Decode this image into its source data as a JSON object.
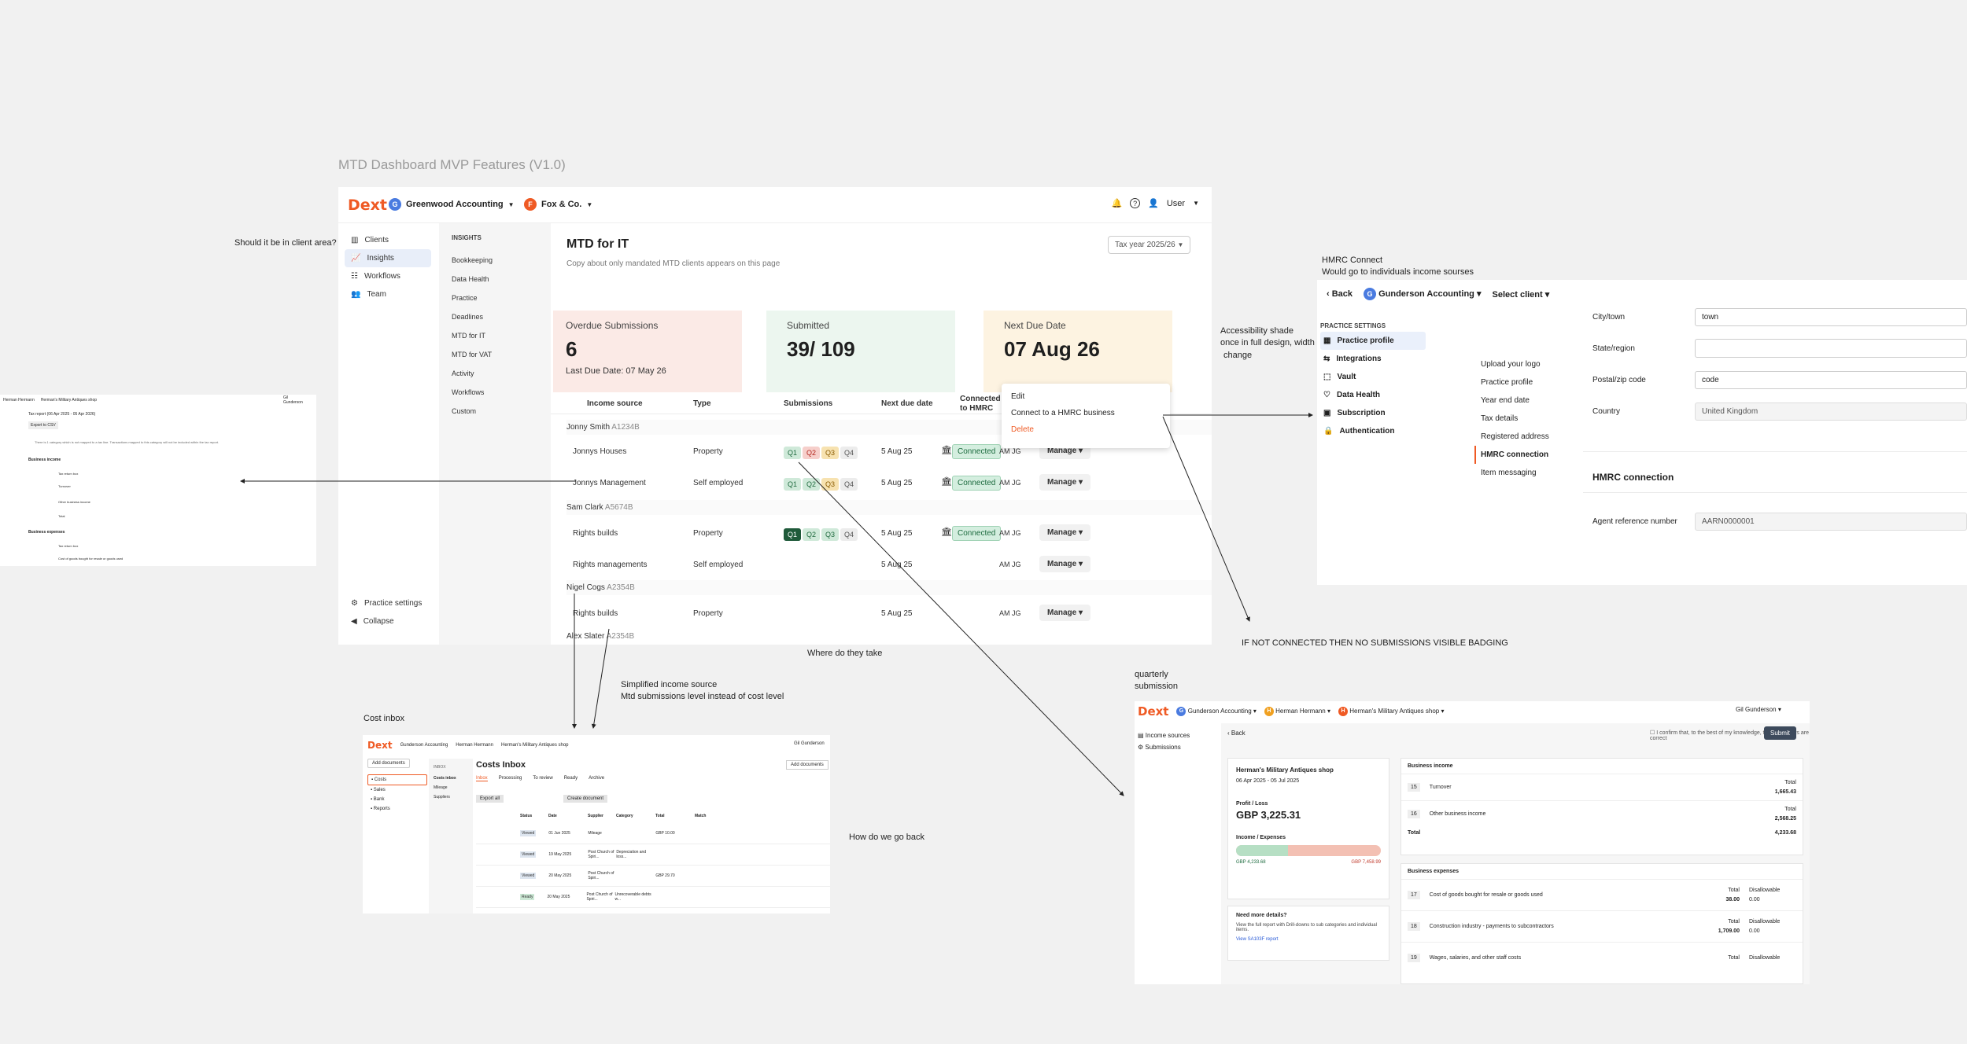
{
  "board": {
    "title": "MTD Dashboard MVP Features (V1.0)"
  },
  "notes": {
    "client_area": "Should it be in client area?",
    "hmrc_connect_1": "HMRC Connect",
    "hmrc_connect_2": "Would go to individuals income sourses",
    "accessibility_1": "Accessibility shade",
    "accessibility_2": "once in full design, width",
    "accessibility_3": "change",
    "not_connected": "IF NOT CONNECTED THEN NO SUBMISSIONS VISIBLE BADGING",
    "where_take": "Where do they take",
    "simplified_1": "Simplified income source",
    "simplified_2": "Mtd submissions level instead of cost level",
    "cost_inbox": "Cost inbox",
    "quarterly_1": "quarterly",
    "quarterly_2": "submission",
    "go_back": "How do we go back"
  },
  "main": {
    "logo": "Dext",
    "org_avatar": "G",
    "org_name": "Greenwood Accounting",
    "client_avatar": "F",
    "client_name": "Fox & Co.",
    "user_label": "User",
    "nav": [
      {
        "label": "Clients"
      },
      {
        "label": "Insights"
      },
      {
        "label": "Workflows"
      },
      {
        "label": "Team"
      }
    ],
    "practice_settings": "Practice settings",
    "collapse": "Collapse",
    "insights_heading": "INSIGHTS",
    "insights_items": [
      "Bookkeeping",
      "Data Health",
      "Practice",
      "Deadlines",
      "MTD for IT",
      "MTD for VAT",
      "Activity",
      "Workflows",
      "Custom"
    ],
    "page_title": "MTD for IT",
    "page_subtitle": "Copy about only mandated MTD clients appears on this page",
    "tax_year": "Tax year 2025/26",
    "cards": {
      "overdue_label": "Overdue Submissions",
      "overdue_value": "6",
      "overdue_sub": "Last Due Date: 07 May 26",
      "submitted_label": "Submitted",
      "submitted_value": "39/ 109",
      "next_label": "Next Due Date",
      "next_value": "07 Aug 26"
    },
    "table_headers": {
      "income": "Income source",
      "type": "Type",
      "submissions": "Submissions",
      "due": "Next due date",
      "connected": "Connected to HMRC"
    },
    "context_menu": {
      "edit": "Edit",
      "connect": "Connect to a HMRC business",
      "delete": "Delete"
    },
    "clients": [
      {
        "name": "Jonny Smith",
        "ref": "A1234B"
      },
      {
        "name": "Sam Clark",
        "ref": "A5674B"
      },
      {
        "name": "Nigel Cogs",
        "ref": "A2354B"
      },
      {
        "name": "Alex Slater",
        "ref": "A2354B"
      }
    ],
    "rows": [
      {
        "income": "Jonnys Houses",
        "type": "Property",
        "q1": "Q1",
        "q2": "Q2",
        "q3": "Q3",
        "q4": "Q4",
        "due": "5 Aug 25",
        "status": "Connected",
        "initials": "AM",
        "initials2": "JG",
        "manage": "Manage"
      },
      {
        "income": "Jonnys Management",
        "type": "Self employed",
        "q1": "Q1",
        "q2": "Q2",
        "q3": "Q3",
        "q4": "Q4",
        "due": "5 Aug 25",
        "status": "Connected",
        "initials": "AM",
        "initials2": "JG",
        "manage": "Manage"
      },
      {
        "income": "Rights builds",
        "type": "Property",
        "q1": "Q1",
        "q2": "Q2",
        "q3": "Q3",
        "q4": "Q4",
        "due": "5 Aug 25",
        "status": "Connected",
        "initials": "AM",
        "initials2": "JG",
        "manage": "Manage"
      },
      {
        "income": "Rights managements",
        "type": "Self employed",
        "due": "5 Aug 25",
        "initials": "AM",
        "initials2": "JG",
        "manage": "Manage"
      },
      {
        "income": "Rights builds",
        "type": "Property",
        "due": "5 Aug 25",
        "initials": "AM",
        "initials2": "JG",
        "manage": "Manage"
      }
    ]
  },
  "hmrc_panel": {
    "back": "Back",
    "org_avatar": "G",
    "org_name": "Gunderson Accounting",
    "select_client": "Select client",
    "settings_heading": "PRACTICE SETTINGS",
    "menu": [
      "Practice profile",
      "Integrations",
      "Vault",
      "Data Health",
      "Subscription",
      "Authentication"
    ],
    "submenu": [
      "Upload your logo",
      "Practice profile",
      "Year end date",
      "Tax details",
      "Registered address",
      "HMRC connection",
      "Item messaging"
    ],
    "fields": {
      "city_label": "City/town",
      "city_value": "town",
      "state_label": "State/region",
      "postal_label": "Postal/zip code",
      "postal_value": "code",
      "country_label": "Country",
      "country_value": "United Kingdom",
      "hmrc_title": "HMRC connection",
      "agent_label": "Agent reference number",
      "agent_value": "AARN0000001"
    }
  },
  "left_panel": {
    "org": "Herman Hermann",
    "client": "Herman's Military Antiques shop",
    "user": "Gil Gunderson",
    "tab1": "Tax report (06 Apr 2025 - 05 Apr 2026)",
    "btn1": "Export to CSV",
    "info": "There is 1 category which is not mapped to a tax line. Transactions mapped to this category will not be included within the tax report.",
    "sec1": "Business income",
    "row1": "Tax return box",
    "row2": "Turnover",
    "row3": "Other business income",
    "row4": "Total",
    "sec2": "Business expenses",
    "row5": "Tax return box",
    "row6": "Cost of goods bought for resale or goods used"
  },
  "cost_panel": {
    "logo": "Dext",
    "org": "Gunderson Accounting",
    "person": "Herman Hermann",
    "client": "Herman's Military Antiques shop",
    "user": "Gil Gunderson",
    "add_docs": "Add documents",
    "nav": [
      "Costs",
      "Sales",
      "Bank",
      "Reports"
    ],
    "sub_heading": "INBOX",
    "sub": [
      "Costs inbox",
      "Mileage",
      "Suppliers"
    ],
    "title": "Costs Inbox",
    "tabs": [
      "Inbox",
      "Processing",
      "To review",
      "Ready",
      "Archive"
    ],
    "actions": [
      "Export all",
      "Create document"
    ],
    "cols": [
      "Status",
      "Date",
      "Supplier",
      "Category",
      "Total",
      "Match"
    ],
    "rows": [
      {
        "status": "Viewed",
        "date": "01 Jun 2025",
        "supplier": "Mileage",
        "category": "",
        "total": "GBP 10.00"
      },
      {
        "status": "Viewed",
        "date": "19 May 2025",
        "supplier": "Post Church of Spiri...",
        "category": "Depreciation and loss...",
        "total": ""
      },
      {
        "status": "Viewed",
        "date": "20 May 2025",
        "supplier": "Post Church of Spiri...",
        "category": "",
        "total": "GBP 29.70"
      },
      {
        "status": "Ready",
        "date": "20 May 2025",
        "supplier": "Post Church of Spiri...",
        "category": "Unrecoverable debts w...",
        "total": ""
      }
    ]
  },
  "quarterly_panel": {
    "logo": "Dext",
    "org": "Gunderson Accounting",
    "person": "Herman Hermann",
    "client": "Herman's Military Antiques shop",
    "user": "Gil Gunderson",
    "nav": [
      "Income sources",
      "Submissions"
    ],
    "back": "Back",
    "confirm": "I confirm that, to the best of my knowledge, these numbers are correct",
    "submit": "Submit",
    "shop_name": "Herman's Military Antiques shop",
    "period": "06 Apr 2025 - 05 Jul 2025",
    "pl_label": "Profit / Loss",
    "pl_value": "GBP 3,225.31",
    "ie_label": "Income / Expenses",
    "income_value": "GBP 4,233.68",
    "expense_value": "GBP 7,458.99",
    "income_share": 0.36,
    "need_more": "Need more details?",
    "need_more_text": "View the full report with Drill-downs to sub categories and individual items.",
    "report_link": "View SA103F report",
    "biz_income": "Business income",
    "income_rows": [
      {
        "box": "15",
        "label": "Turnover",
        "total_label": "Total",
        "total": "1,665.43"
      },
      {
        "box": "16",
        "label": "Other business income",
        "total_label": "Total",
        "total": "2,568.25"
      }
    ],
    "income_total_label": "Total",
    "income_total": "4,233.68",
    "biz_expenses": "Business expenses",
    "expense_rows": [
      {
        "box": "17",
        "label": "Cost of goods bought for resale or goods used",
        "total_label": "Total",
        "total": "38.00",
        "dis_label": "Disallowable",
        "dis": "0.00"
      },
      {
        "box": "18",
        "label": "Construction industry - payments to subcontractors",
        "total_label": "Total",
        "total": "1,709.00",
        "dis_label": "Disallowable",
        "dis": "0.00"
      },
      {
        "box": "19",
        "label": "Wages, salaries, and other staff costs",
        "total_label": "Total",
        "total": "",
        "dis_label": "Disallowable",
        "dis": ""
      }
    ]
  },
  "colors": {
    "brand": "#ef5a24",
    "overdue_bg": "#fbeae6",
    "submitted_bg": "#ecf6ef",
    "next_bg": "#fdf3e1",
    "connected": "#1d6b3f"
  }
}
